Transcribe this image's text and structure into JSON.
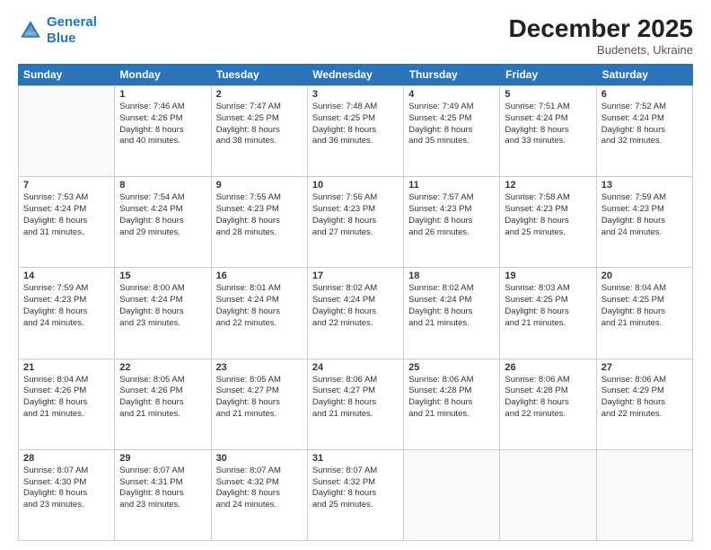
{
  "header": {
    "logo_line1": "General",
    "logo_line2": "Blue",
    "month": "December 2025",
    "location": "Budenets, Ukraine"
  },
  "weekdays": [
    "Sunday",
    "Monday",
    "Tuesday",
    "Wednesday",
    "Thursday",
    "Friday",
    "Saturday"
  ],
  "rows": [
    [
      {
        "day": "",
        "empty": true
      },
      {
        "day": "1",
        "lines": [
          "Sunrise: 7:46 AM",
          "Sunset: 4:26 PM",
          "Daylight: 8 hours",
          "and 40 minutes."
        ]
      },
      {
        "day": "2",
        "lines": [
          "Sunrise: 7:47 AM",
          "Sunset: 4:25 PM",
          "Daylight: 8 hours",
          "and 38 minutes."
        ]
      },
      {
        "day": "3",
        "lines": [
          "Sunrise: 7:48 AM",
          "Sunset: 4:25 PM",
          "Daylight: 8 hours",
          "and 36 minutes."
        ]
      },
      {
        "day": "4",
        "lines": [
          "Sunrise: 7:49 AM",
          "Sunset: 4:25 PM",
          "Daylight: 8 hours",
          "and 35 minutes."
        ]
      },
      {
        "day": "5",
        "lines": [
          "Sunrise: 7:51 AM",
          "Sunset: 4:24 PM",
          "Daylight: 8 hours",
          "and 33 minutes."
        ]
      },
      {
        "day": "6",
        "lines": [
          "Sunrise: 7:52 AM",
          "Sunset: 4:24 PM",
          "Daylight: 8 hours",
          "and 32 minutes."
        ]
      }
    ],
    [
      {
        "day": "7",
        "lines": [
          "Sunrise: 7:53 AM",
          "Sunset: 4:24 PM",
          "Daylight: 8 hours",
          "and 31 minutes."
        ]
      },
      {
        "day": "8",
        "lines": [
          "Sunrise: 7:54 AM",
          "Sunset: 4:24 PM",
          "Daylight: 8 hours",
          "and 29 minutes."
        ]
      },
      {
        "day": "9",
        "lines": [
          "Sunrise: 7:55 AM",
          "Sunset: 4:23 PM",
          "Daylight: 8 hours",
          "and 28 minutes."
        ]
      },
      {
        "day": "10",
        "lines": [
          "Sunrise: 7:56 AM",
          "Sunset: 4:23 PM",
          "Daylight: 8 hours",
          "and 27 minutes."
        ]
      },
      {
        "day": "11",
        "lines": [
          "Sunrise: 7:57 AM",
          "Sunset: 4:23 PM",
          "Daylight: 8 hours",
          "and 26 minutes."
        ]
      },
      {
        "day": "12",
        "lines": [
          "Sunrise: 7:58 AM",
          "Sunset: 4:23 PM",
          "Daylight: 8 hours",
          "and 25 minutes."
        ]
      },
      {
        "day": "13",
        "lines": [
          "Sunrise: 7:59 AM",
          "Sunset: 4:23 PM",
          "Daylight: 8 hours",
          "and 24 minutes."
        ]
      }
    ],
    [
      {
        "day": "14",
        "lines": [
          "Sunrise: 7:59 AM",
          "Sunset: 4:23 PM",
          "Daylight: 8 hours",
          "and 24 minutes."
        ]
      },
      {
        "day": "15",
        "lines": [
          "Sunrise: 8:00 AM",
          "Sunset: 4:24 PM",
          "Daylight: 8 hours",
          "and 23 minutes."
        ]
      },
      {
        "day": "16",
        "lines": [
          "Sunrise: 8:01 AM",
          "Sunset: 4:24 PM",
          "Daylight: 8 hours",
          "and 22 minutes."
        ]
      },
      {
        "day": "17",
        "lines": [
          "Sunrise: 8:02 AM",
          "Sunset: 4:24 PM",
          "Daylight: 8 hours",
          "and 22 minutes."
        ]
      },
      {
        "day": "18",
        "lines": [
          "Sunrise: 8:02 AM",
          "Sunset: 4:24 PM",
          "Daylight: 8 hours",
          "and 21 minutes."
        ]
      },
      {
        "day": "19",
        "lines": [
          "Sunrise: 8:03 AM",
          "Sunset: 4:25 PM",
          "Daylight: 8 hours",
          "and 21 minutes."
        ]
      },
      {
        "day": "20",
        "lines": [
          "Sunrise: 8:04 AM",
          "Sunset: 4:25 PM",
          "Daylight: 8 hours",
          "and 21 minutes."
        ]
      }
    ],
    [
      {
        "day": "21",
        "lines": [
          "Sunrise: 8:04 AM",
          "Sunset: 4:26 PM",
          "Daylight: 8 hours",
          "and 21 minutes."
        ]
      },
      {
        "day": "22",
        "lines": [
          "Sunrise: 8:05 AM",
          "Sunset: 4:26 PM",
          "Daylight: 8 hours",
          "and 21 minutes."
        ]
      },
      {
        "day": "23",
        "lines": [
          "Sunrise: 8:05 AM",
          "Sunset: 4:27 PM",
          "Daylight: 8 hours",
          "and 21 minutes."
        ]
      },
      {
        "day": "24",
        "lines": [
          "Sunrise: 8:06 AM",
          "Sunset: 4:27 PM",
          "Daylight: 8 hours",
          "and 21 minutes."
        ]
      },
      {
        "day": "25",
        "lines": [
          "Sunrise: 8:06 AM",
          "Sunset: 4:28 PM",
          "Daylight: 8 hours",
          "and 21 minutes."
        ]
      },
      {
        "day": "26",
        "lines": [
          "Sunrise: 8:06 AM",
          "Sunset: 4:28 PM",
          "Daylight: 8 hours",
          "and 22 minutes."
        ]
      },
      {
        "day": "27",
        "lines": [
          "Sunrise: 8:06 AM",
          "Sunset: 4:29 PM",
          "Daylight: 8 hours",
          "and 22 minutes."
        ]
      }
    ],
    [
      {
        "day": "28",
        "lines": [
          "Sunrise: 8:07 AM",
          "Sunset: 4:30 PM",
          "Daylight: 8 hours",
          "and 23 minutes."
        ]
      },
      {
        "day": "29",
        "lines": [
          "Sunrise: 8:07 AM",
          "Sunset: 4:31 PM",
          "Daylight: 8 hours",
          "and 23 minutes."
        ]
      },
      {
        "day": "30",
        "lines": [
          "Sunrise: 8:07 AM",
          "Sunset: 4:32 PM",
          "Daylight: 8 hours",
          "and 24 minutes."
        ]
      },
      {
        "day": "31",
        "lines": [
          "Sunrise: 8:07 AM",
          "Sunset: 4:32 PM",
          "Daylight: 8 hours",
          "and 25 minutes."
        ]
      },
      {
        "day": "",
        "empty": true
      },
      {
        "day": "",
        "empty": true
      },
      {
        "day": "",
        "empty": true
      }
    ]
  ]
}
